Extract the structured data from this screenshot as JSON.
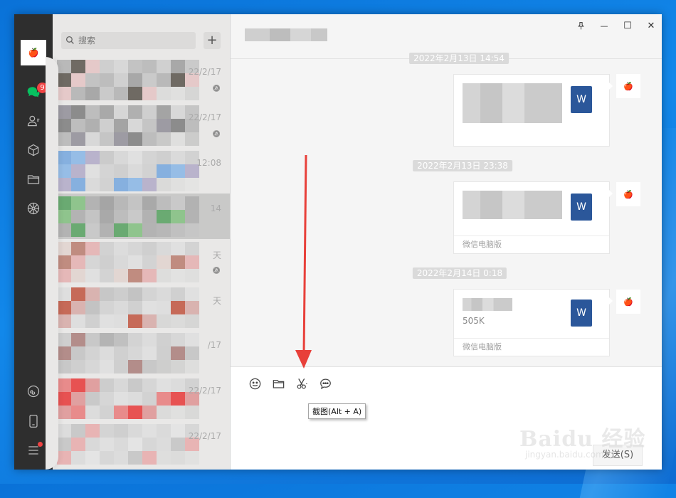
{
  "desktop": {
    "glow": true
  },
  "rail": {
    "badge_count": "9",
    "icons": [
      "chat-icon",
      "contacts-icon",
      "favorites-icon",
      "files-icon",
      "moments-icon",
      "mini-program-icon",
      "phone-icon",
      "menu-icon"
    ]
  },
  "list": {
    "search_placeholder": "搜索",
    "add_label": "+",
    "items": [
      {
        "time": "22/2/17",
        "muted": true
      },
      {
        "time": "22/2/17",
        "muted": true
      },
      {
        "time": "12:08",
        "muted": false
      },
      {
        "time": "14",
        "muted": false
      },
      {
        "time": "天",
        "muted": true
      },
      {
        "time": "天",
        "muted": false
      },
      {
        "time": "/17",
        "muted": false
      },
      {
        "time": "22/2/17",
        "muted": false
      },
      {
        "time": "22/2/17",
        "muted": false
      }
    ]
  },
  "header": {
    "pin_glyph": "⚲",
    "min_glyph": "—",
    "max_glyph": "☐",
    "close_glyph": "✕"
  },
  "messages": [
    {
      "timestamp": "2022年2月13日 14:54",
      "file_size": "",
      "source": "",
      "word_letter": "W"
    },
    {
      "timestamp": "2022年2月13日 23:38",
      "file_size": "",
      "source": "微信电脑版",
      "word_letter": "W"
    },
    {
      "timestamp": "2022年2月14日 0:18",
      "file_size": "505K",
      "source": "微信电脑版",
      "word_letter": "W"
    }
  ],
  "composer": {
    "tooltip": "截图(Alt + A)",
    "send_label": "发送(S)"
  },
  "watermark": {
    "main": "Baidu 经验",
    "sub": "jingyan.baidu.com"
  },
  "colors": {
    "rail": "#2e2e2e",
    "list_bg": "#e9e8e7",
    "accent_green": "#07c160",
    "badge": "#f04444",
    "word": "#2b579a",
    "arrow": "#e8403a"
  }
}
